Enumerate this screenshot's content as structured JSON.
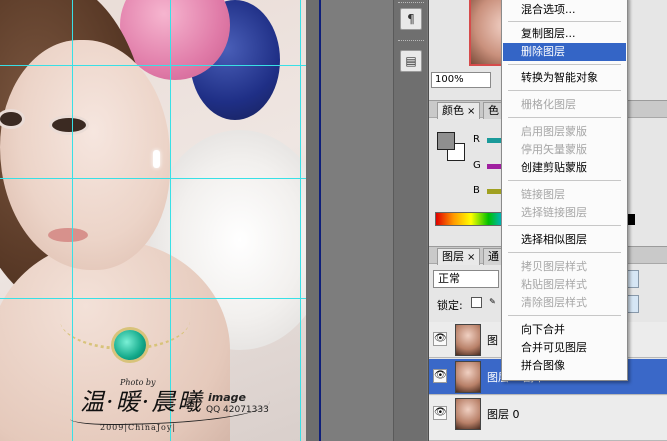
{
  "canvas": {
    "watermark": {
      "photo_by": "Photo by",
      "title": "温·暖·晨曦",
      "image_word": "image",
      "qq": "QQ 42071333",
      "year_line": "2009|ChinaJoy|"
    }
  },
  "dock": {
    "buttons": [
      "¶",
      "▤"
    ]
  },
  "panels": {
    "navigator": {
      "zoom": "100%"
    },
    "color": {
      "tabs": [
        "颜色",
        "色"
      ],
      "close": "×",
      "channels": [
        {
          "label": "R",
          "color": "#1a9a9a"
        },
        {
          "label": "G",
          "color": "#a020a0"
        },
        {
          "label": "B",
          "color": "#a0a020"
        }
      ],
      "foreground": "#8f8f8f",
      "background": "#ffffff"
    },
    "layers": {
      "tabs": [
        "图层",
        "通"
      ],
      "close": "×",
      "blend_mode": "正常",
      "lock_label": "锁定:",
      "rows": [
        {
          "name": "图",
          "selected": false
        },
        {
          "name": "图层 1 副本",
          "selected": true
        },
        {
          "name": "图层 0",
          "selected": false
        }
      ],
      "eye": "👁"
    }
  },
  "context_menu": {
    "items": [
      {
        "label": "混合选项...",
        "enabled": true,
        "highlighted": false
      },
      {
        "label": "复制图层...",
        "enabled": true,
        "highlighted": false
      },
      {
        "label": "删除图层",
        "enabled": true,
        "highlighted": true
      },
      {
        "label": "转换为智能对象",
        "enabled": true,
        "highlighted": false
      },
      {
        "label": "栅格化图层",
        "enabled": false,
        "highlighted": false
      },
      {
        "label": "启用图层蒙版",
        "enabled": false,
        "highlighted": false
      },
      {
        "label": "停用矢量蒙版",
        "enabled": false,
        "highlighted": false
      },
      {
        "label": "创建剪贴蒙版",
        "enabled": true,
        "highlighted": false
      },
      {
        "label": "链接图层",
        "enabled": false,
        "highlighted": false
      },
      {
        "label": "选择链接图层",
        "enabled": false,
        "highlighted": false
      },
      {
        "label": "选择相似图层",
        "enabled": true,
        "highlighted": false
      },
      {
        "label": "拷贝图层样式",
        "enabled": false,
        "highlighted": false
      },
      {
        "label": "粘贴图层样式",
        "enabled": false,
        "highlighted": false
      },
      {
        "label": "清除图层样式",
        "enabled": false,
        "highlighted": false
      },
      {
        "label": "向下合并",
        "enabled": true,
        "highlighted": false
      },
      {
        "label": "合并可见图层",
        "enabled": true,
        "highlighted": false
      },
      {
        "label": "拼合图像",
        "enabled": true,
        "highlighted": false
      }
    ]
  }
}
